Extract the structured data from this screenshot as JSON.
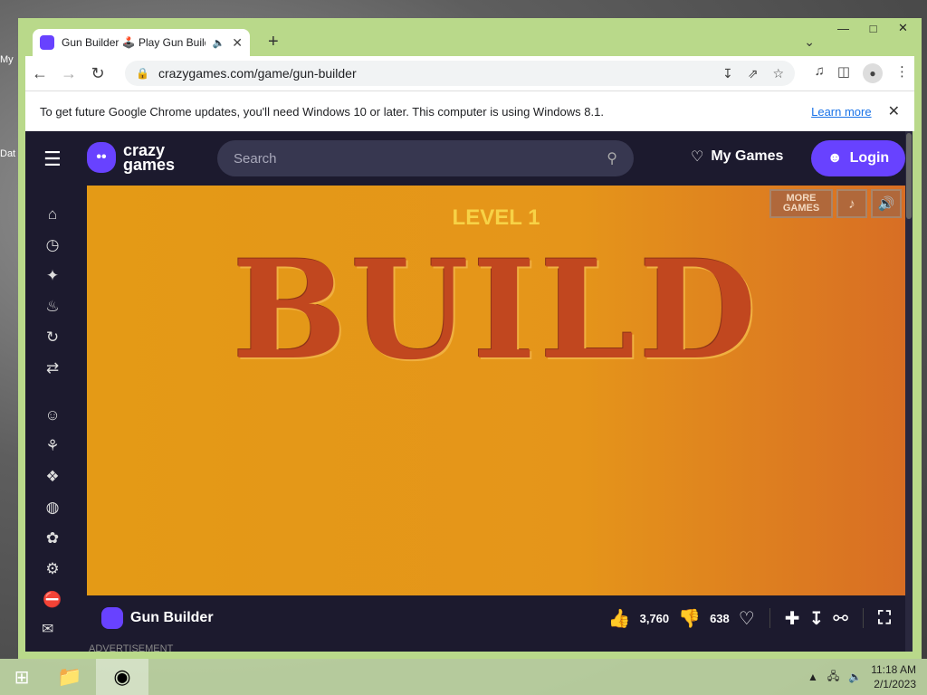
{
  "desktop": {
    "icon_labels": [
      "My",
      "Dat"
    ]
  },
  "browser": {
    "tab": {
      "title": "Gun Builder 🕹️ Play Gun Builder",
      "audio_icon": "speaker-icon"
    },
    "url": "crazygames.com/game/gun-builder",
    "infobar": {
      "message": "To get future Google Chrome updates, you'll need Windows 10 or later. This computer is using Windows 8.1.",
      "link": "Learn more"
    }
  },
  "site": {
    "logo_line1": "crazy",
    "logo_line2": "games",
    "search_placeholder": "Search",
    "my_games": "My Games",
    "login": "Login",
    "sidebar_icons": [
      "home-icon",
      "clock-icon",
      "sparkle-icon",
      "fire-icon",
      "refresh-icon",
      "shuffle-icon",
      "multiplayer-icon",
      "grass-icon",
      "compass-icon",
      "basketball-icon",
      "flower-icon",
      "bike-icon",
      "car-icon"
    ]
  },
  "game": {
    "level_text": "LEVEL 1",
    "build_text": "BUILD",
    "more_games": "MORE GAMES",
    "title": "Gun Builder",
    "likes": "3,760",
    "dislikes": "638",
    "ad_label": "ADVERTISEMENT"
  },
  "taskbar": {
    "time": "11:18 AM",
    "date": "2/1/2023"
  }
}
